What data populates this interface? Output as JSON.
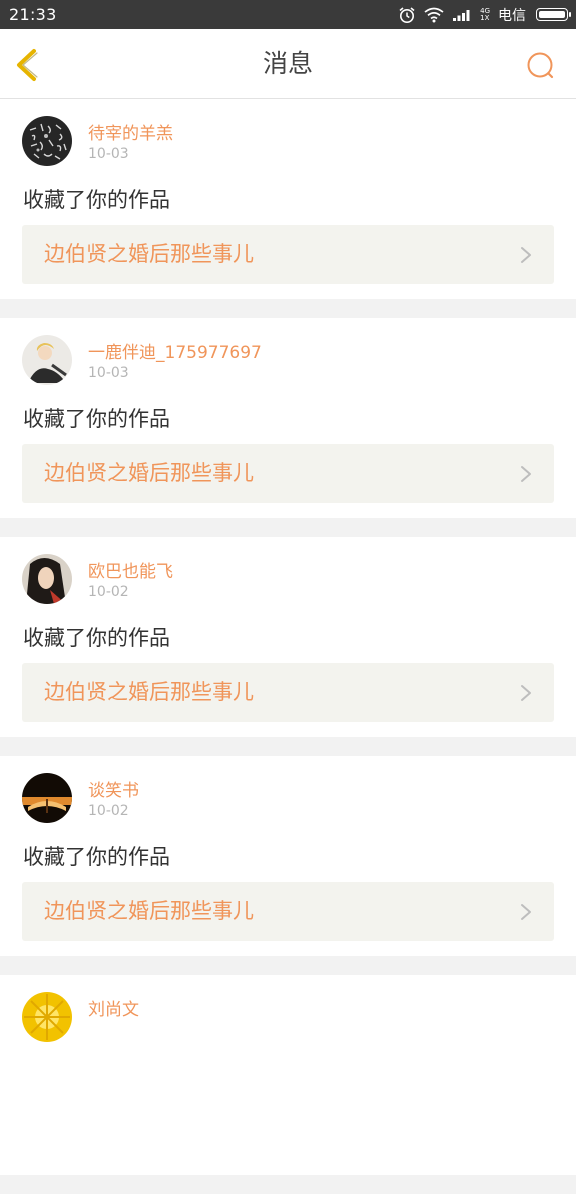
{
  "status_bar": {
    "time": "21:33",
    "network_top": "4G",
    "network_bottom": "1X",
    "carrier": "电信",
    "icons": [
      "alarm-icon",
      "wifi-icon",
      "signal-icon",
      "battery-icon"
    ]
  },
  "header": {
    "title": "消息",
    "back_icon": "chevron-left-icon",
    "search_icon": "search-icon"
  },
  "colors": {
    "accent": "#f0955a",
    "back_icon": "#e6b400",
    "status_bar_bg": "#3a3a3a"
  },
  "messages": [
    {
      "name": "待宰的羊羔",
      "date": "10-03",
      "action": "收藏了你的作品",
      "work": "边伯贤之婚后那些事儿"
    },
    {
      "name": "一鹿伴迪_175977697",
      "date": "10-03",
      "action": "收藏了你的作品",
      "work": "边伯贤之婚后那些事儿"
    },
    {
      "name": "欧巴也能飞",
      "date": "10-02",
      "action": "收藏了你的作品",
      "work": "边伯贤之婚后那些事儿"
    },
    {
      "name": "谈笑书",
      "date": "10-02",
      "action": "收藏了你的作品",
      "work": "边伯贤之婚后那些事儿"
    },
    {
      "name": "刘尚文"
    }
  ]
}
